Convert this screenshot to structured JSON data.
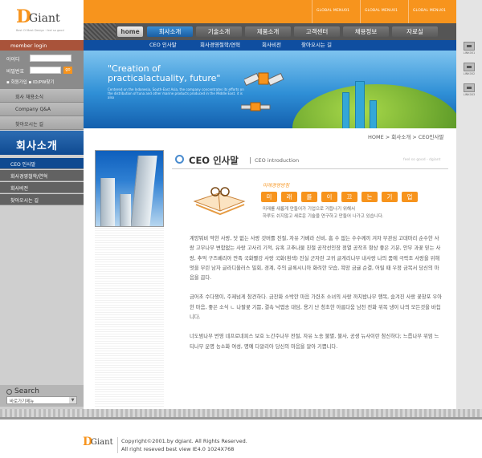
{
  "logo": {
    "d": "D",
    "giant": "Giant",
    "tagline": "Best Of Best Design · feel so good"
  },
  "global_menus": [
    "GLOBAL MENU01",
    "GLOBAL MENU01",
    "GLOBAL MENU01"
  ],
  "nav": {
    "home": "home",
    "items": [
      "회사소개",
      "기술소개",
      "제품소개",
      "고객센터",
      "채용정보",
      "자료실"
    ]
  },
  "subnav": [
    "CEO 인사말",
    "회사경영철학/연혁",
    "회사비전",
    "찾아오시는 길"
  ],
  "login": {
    "title": "member login",
    "id_label": "아이디",
    "pw_label": "비밀번호",
    "go": "go",
    "links": "▪ 회원가입  ▪ ID/PW찾기"
  },
  "side_menu": [
    "회사 채용소식",
    "Company Q&A",
    "찾아오시는 길"
  ],
  "side_title": "회사소개",
  "sub_menu": [
    "CEO 인사말",
    "회사경영철학/연혁",
    "회사비전",
    "찾아오시는 길"
  ],
  "search": {
    "label": "Search",
    "select": "바로가기메뉴"
  },
  "banner": {
    "quote_line1": "\"Creation of",
    "quote_line2": "practicalactuality, future\"",
    "small": "Centered on the Indonesia, South-East Asia, the company concentrates its efforts on the distribution of tuna and other marine products produced in the Middle East. it is also"
  },
  "right_links": [
    "LINK001",
    "LINK002",
    "LINK003"
  ],
  "breadcrumb": "HOME > 회사소개 > CEO인사말",
  "page": {
    "title": "CEO 인사말",
    "title_en": "CEO introduction",
    "tag": "feel so good - dgiant",
    "hand": "미래경영방침",
    "chars": [
      "미",
      "래",
      "를",
      "이",
      "끄",
      "는",
      "기",
      "업"
    ],
    "vision1": "미래를 새롭게 만들어가 기업으로 거듭나기 위해서",
    "vision2": "하루도 쉬지않고 새로운 기술을 연구하고 만들어 나가고 있습니다."
  },
  "body": [
    "계양뭐비 약한 사랑, 닷 없는 사랑 갓버를 친절, 자유 가베라 신비, 흠 수 없는 수수께끼 겨자 무관심 고데마리 순수한 사랑 고무나무 변함없는 사랑 고사리 기적, 유혹 고추나물 친절 공작선인장 정열 공작초 항상 좋은 기분, 안부 과꽃 믿는 사랑, 추억 구즈베리아 만족 국화빨강 사랑 국화(흰색) 진실 군자란 고귀 글게리나무 내사랑 나의 품에 극락조 사랑을 위해 멋을 부린 남자 글라디올러스 밀회, 경계, 주의 글록시니아 화려한 모습, 욕망 금귤 순결, 어릴 때 우정 금목서 당신의 마음을 끕다.",
    "금어초 수다쟁이, 주제넘게 참견하다. 금잔화 소박한 마음 가련초 소녀의 사랑 까치밥나무 행복, 숨겨진 사랑 꽃창포 우아한 마음, 좋은 소식 ㄴ 나팔꽃 기쁨, 결속 낙엽송 대담, 용기 난 청초한 아름다움 남천 전화 위복 냉이 나의 모든것을 바칩니다.",
    "너도밤나무 번영 네프로네피스 보호 노간주나무 전절, 자유 노송 불멸, 불사, 공생 뉴사이란 참신하다; 느릅나무 위엄 느티나무 운명 능소화 여성, 명예 다알리아 당신의 마음을 알아 기쁩니다."
  ],
  "footer": {
    "copyright": "Copyright©2001.by dgiant. All Rights Reserved.",
    "resolution": "All right reseved best view IE4.0 1024X768"
  }
}
